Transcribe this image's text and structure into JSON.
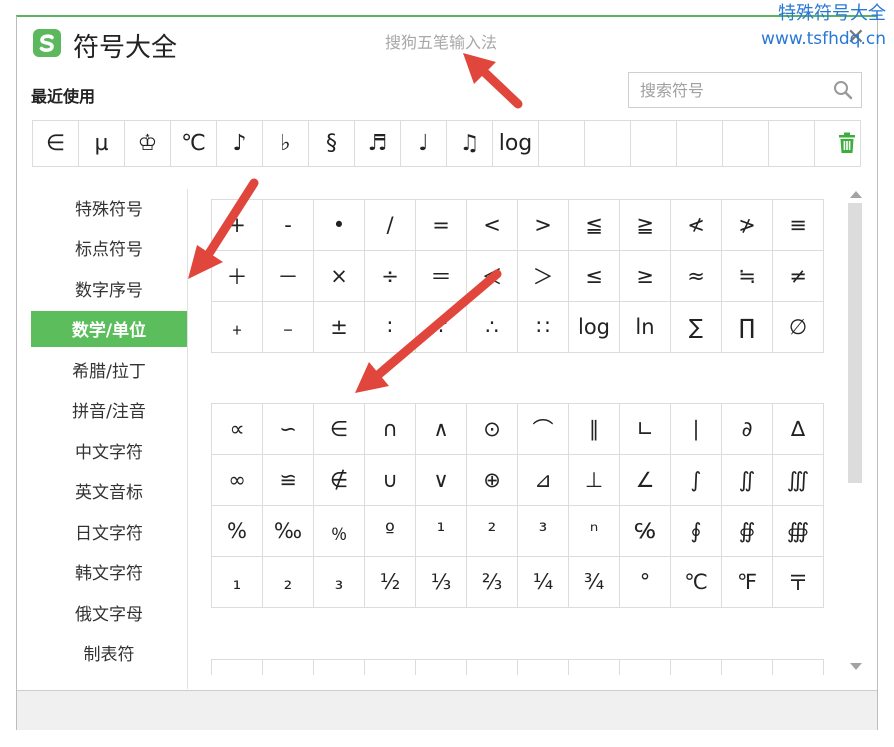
{
  "watermark": {
    "line1": "特殊符号大全",
    "line2": "www.tsfhdq.cn"
  },
  "window": {
    "title": "符号大全",
    "ime_name": "搜狗五笔输入法",
    "close_label": "✕"
  },
  "recent": {
    "label": "最近使用",
    "symbols": [
      "∈",
      "µ",
      "♔",
      "℃",
      "♪",
      "♭",
      "§",
      "♬",
      "♩",
      "♫",
      "log",
      "",
      "",
      "",
      "",
      "",
      "",
      ""
    ]
  },
  "search": {
    "placeholder": "搜索符号",
    "value": ""
  },
  "categories": [
    "特殊符号",
    "标点符号",
    "数字序号",
    "数学/单位",
    "希腊/拉丁",
    "拼音/注音",
    "中文字符",
    "英文音标",
    "日文字符",
    "韩文字符",
    "俄文字母",
    "制表符"
  ],
  "active_category": "数学/单位",
  "grid_sections": [
    [
      "+",
      "-",
      "•",
      "/",
      "=",
      "<",
      ">",
      "≦",
      "≧",
      "≮",
      "≯",
      "≡",
      "＋",
      "－",
      "×",
      "÷",
      "＝",
      "＜",
      "＞",
      "≤",
      "≥",
      "≈",
      "≒",
      "≠",
      "﹢",
      "﹣",
      "±",
      "∶",
      "∵",
      "∴",
      "∷",
      "log",
      "ln",
      "∑",
      "∏",
      "∅"
    ],
    [
      "∝",
      "∽",
      "∈",
      "∩",
      "∧",
      "⊙",
      "⌒",
      "∥",
      "∟",
      "∣",
      "∂",
      "∆",
      "∞",
      "≌",
      "∉",
      "∪",
      "∨",
      "⊕",
      "⊿",
      "⊥",
      "∠",
      "∫",
      "∬",
      "∭",
      "%",
      "‰",
      "﹪",
      "º",
      "¹",
      "²",
      "³",
      "ⁿ",
      "℅",
      "∮",
      "∯",
      "∰",
      "₁",
      "₂",
      "₃",
      "½",
      "⅓",
      "⅔",
      "¼",
      "¾",
      "°",
      "℃",
      "℉",
      "〒"
    ],
    [
      "",
      "",
      "",
      "",
      "",
      "",
      "",
      "",
      "",
      "",
      "",
      ""
    ]
  ],
  "colors": {
    "accent": "#5bbd5b",
    "watermark": "#2a78d6",
    "arrow": "#e0463c",
    "border": "#dcdcdc"
  },
  "icons": {
    "logo": "sogou-s-logo-icon",
    "search": "magnifier-icon",
    "trash": "trash-icon",
    "close": "close-icon"
  }
}
